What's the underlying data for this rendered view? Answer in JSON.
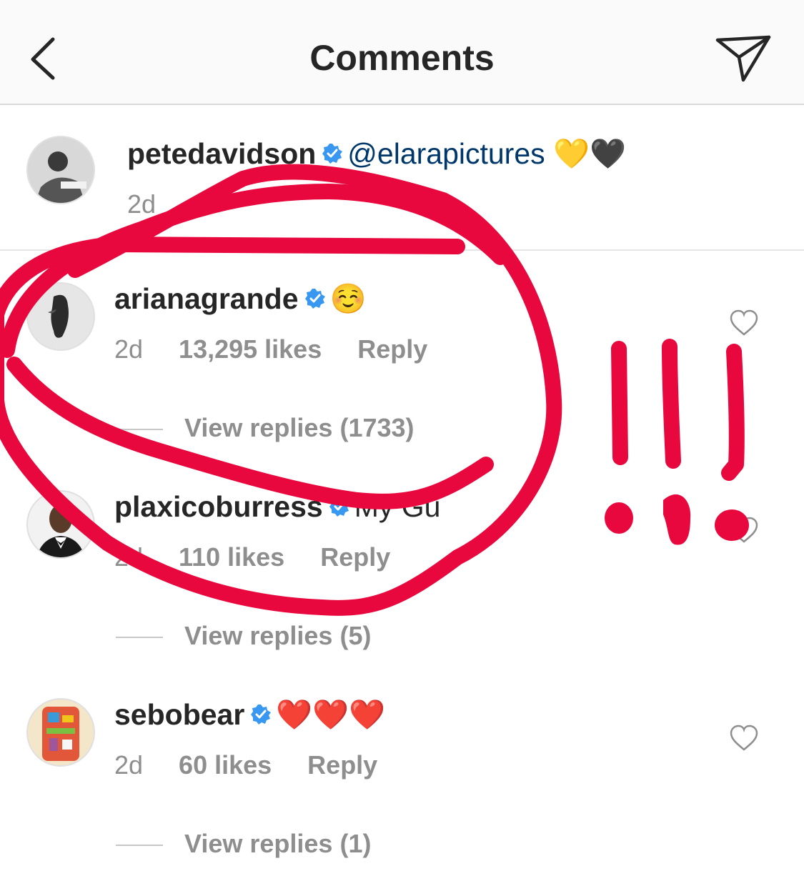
{
  "header": {
    "title": "Comments"
  },
  "caption": {
    "username": "petedavidson",
    "mention": "@elarapictures",
    "emojis": "💛🖤",
    "time": "2d"
  },
  "comments": [
    {
      "username": "arianagrande",
      "text": "☺️",
      "time": "2d",
      "likes": "13,295 likes",
      "reply": "Reply",
      "view_replies": "View replies (1733)"
    },
    {
      "username": "plaxicoburress",
      "text": "My Gu",
      "time": "2d",
      "likes": "110 likes",
      "reply": "Reply",
      "view_replies": "View replies (5)"
    },
    {
      "username": "sebobear",
      "text": "❤️❤️❤️",
      "time": "2d",
      "likes": "60 likes",
      "reply": "Reply",
      "view_replies": "View replies (1)"
    }
  ],
  "colors": {
    "annotation": "#e8083e",
    "verified": "#3897f0",
    "secondary_text": "#8e8e8e"
  }
}
